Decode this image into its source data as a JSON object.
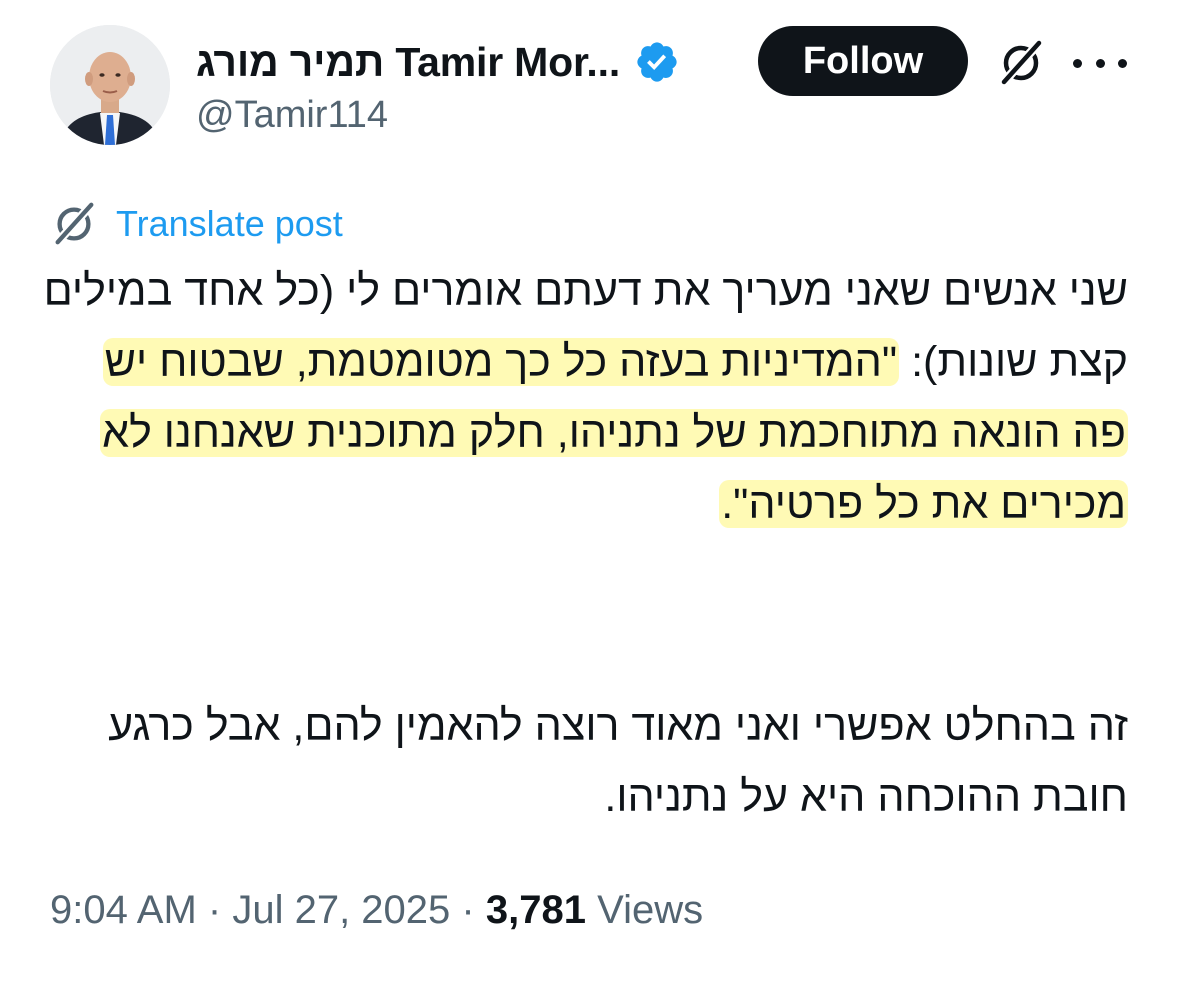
{
  "header": {
    "display_name": "תמיר מורג Tamir Mor...",
    "handle": "@Tamir114",
    "follow_label": "Follow"
  },
  "icons": {
    "avatar": "profile-photo",
    "verified": "verified-badge-icon",
    "grok": "grok-icon",
    "more": "more-horizontal-icon",
    "translate": "grok-translate-icon"
  },
  "colors": {
    "accent": "#1d9bf0",
    "follow_bg": "#0f1419",
    "secondary_text": "#536471",
    "highlight": "#fff578"
  },
  "translate": {
    "label": "Translate post"
  },
  "tweet": {
    "p1_a": "שני אנשים שאני מעריך את דעתם אומרים לי (כל אחד במילים קצת שונות): ",
    "p1_highlighted": "\"המדיניות בעזה כל כך מטומטמת, שבטוח יש פה הונאה מתוחכמת של נתניהו, חלק מתוכנית שאנחנו לא מכירים את כל פרטיה\".",
    "p2": "זה בהחלט אפשרי ואני מאוד רוצה להאמין להם, אבל כרגע חובת ההוכחה היא על נתניהו."
  },
  "meta": {
    "time": "9:04 AM",
    "separator": "·",
    "date": "Jul 27, 2025",
    "views_count": "3,781",
    "views_label": "Views"
  }
}
